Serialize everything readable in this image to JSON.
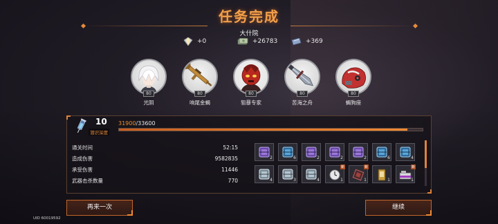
{
  "header": {
    "title": "任务完成",
    "location": "大什院"
  },
  "currencies": [
    {
      "icon": "crystal-icon",
      "value": "+0"
    },
    {
      "icon": "cash-icon",
      "value": "+26783"
    },
    {
      "icon": "ticket-icon",
      "value": "+369"
    }
  ],
  "characters": [
    {
      "name": "光阴",
      "level": "80",
      "icon": "white-hair-character-portrait"
    },
    {
      "name": "响尾金蝎",
      "level": "80",
      "icon": "golden-rifle-portrait"
    },
    {
      "name": "狙暴专家",
      "level": "80",
      "icon": "red-mask-character-portrait"
    },
    {
      "name": "苦海之舟",
      "level": "80",
      "icon": "silver-blade-portrait"
    },
    {
      "name": "蝎狗座",
      "level": "80",
      "icon": "red-mech-portrait"
    }
  ],
  "depth": {
    "value": "10",
    "label": "潜识深度"
  },
  "experience": {
    "current": "31900",
    "max": "33600",
    "progress": 0.949
  },
  "stats": [
    {
      "label": "通关时间",
      "value": "52:15"
    },
    {
      "label": "造成伤害",
      "value": "9582835"
    },
    {
      "label": "承受伤害",
      "value": "11446"
    },
    {
      "label": "武器击杀数量",
      "value": "770"
    }
  ],
  "items": [
    {
      "icon": "purple-cube-icon",
      "count": "2"
    },
    {
      "icon": "blue-cube-icon",
      "count": "6"
    },
    {
      "icon": "purple-cube-icon",
      "count": "2"
    },
    {
      "icon": "purple-cube-icon",
      "count": "2"
    },
    {
      "icon": "purple-cube-icon",
      "count": "2"
    },
    {
      "icon": "blue-cube-icon",
      "count": "6"
    },
    {
      "icon": "blue-cube-icon",
      "count": "4"
    },
    {
      "icon": "silver-cube-icon",
      "count": "4"
    },
    {
      "icon": "silver-cube-icon",
      "count": "3"
    },
    {
      "icon": "silver-cube-icon",
      "count": "4"
    },
    {
      "icon": "clock-icon",
      "count": "1",
      "badge": "新"
    },
    {
      "icon": "chip-icon",
      "count": "1",
      "badge": "新"
    },
    {
      "icon": "card-icon",
      "count": "1"
    },
    {
      "icon": "folder-icon",
      "count": "1",
      "badge": "新"
    }
  ],
  "buttons": {
    "retry": "再来一次",
    "continue": "继续"
  },
  "footer": {
    "uid": "UID 60019592"
  },
  "colors": {
    "accent": "#f0902f",
    "panel_border": "#5a4030"
  }
}
